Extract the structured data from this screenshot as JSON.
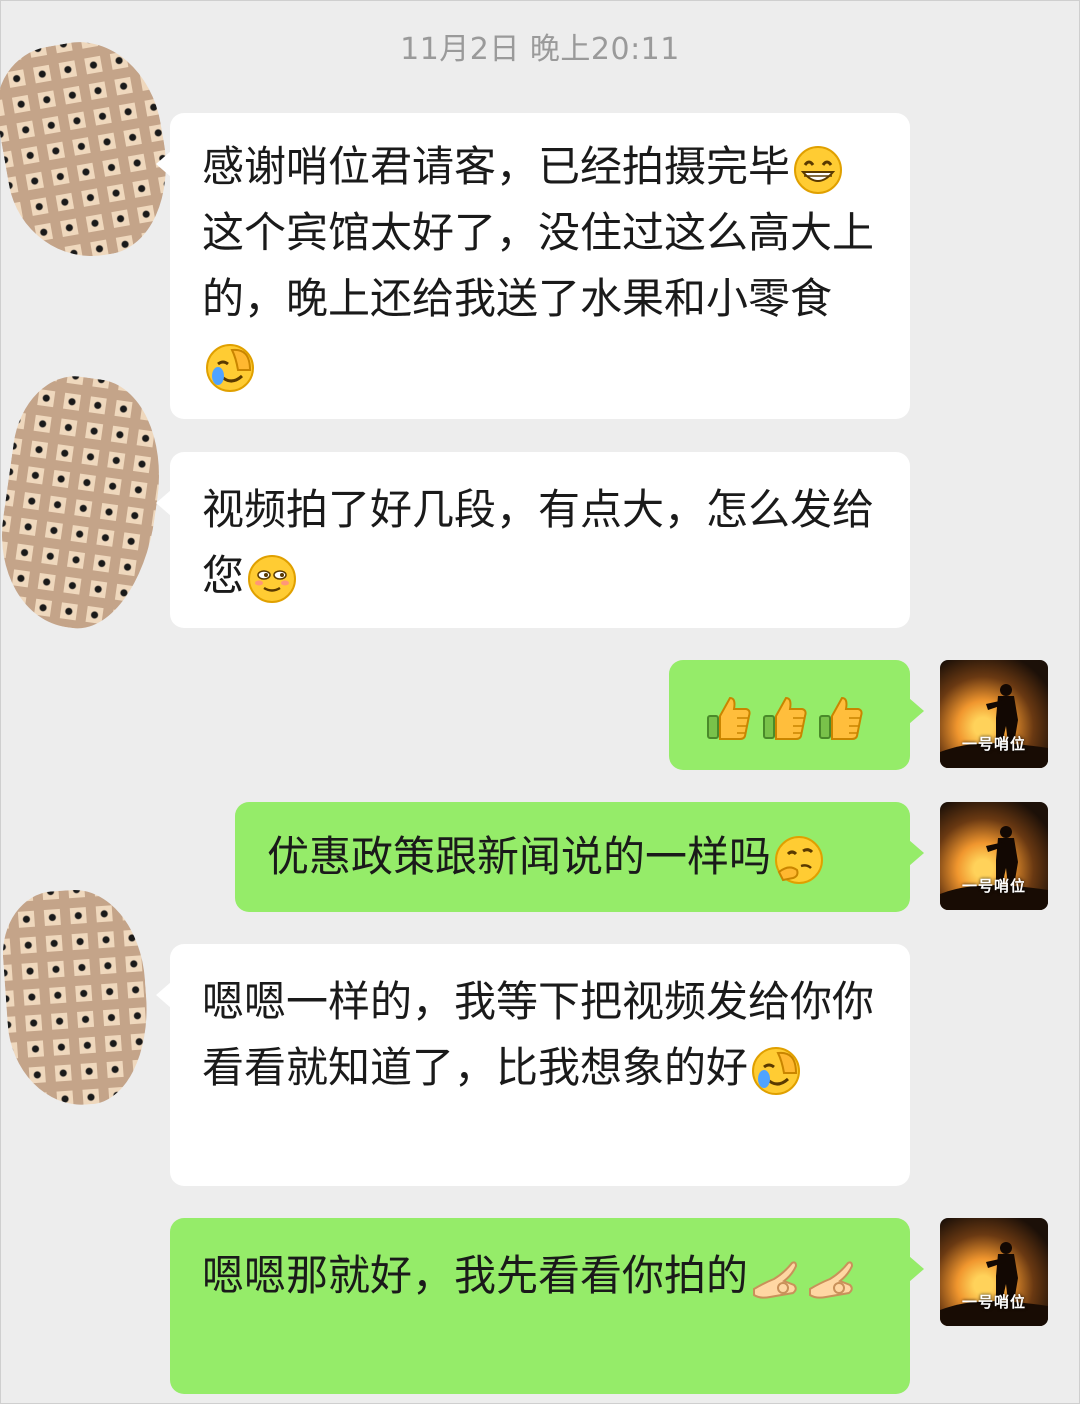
{
  "conversation": {
    "timestamp": "11月2日 晚上20:11",
    "self_avatar_label": "一号哨位",
    "messages": [
      {
        "sender": "other",
        "segments": [
          {
            "text": "感谢哨位君请客，已经拍摄完毕"
          },
          {
            "emoji": "grin-emoji"
          },
          {
            "text": "这个宾馆太好了，没住过这么高大上的，晚上还给我送了水果和小零食"
          },
          {
            "emoji": "facepalm-emoji"
          }
        ]
      },
      {
        "sender": "other",
        "segments": [
          {
            "text": "视频拍了好几段，有点大，怎么发给您"
          },
          {
            "emoji": "shy-emoji"
          }
        ]
      },
      {
        "sender": "self",
        "segments": [
          {
            "emoji": "thumbs-up-emoji"
          },
          {
            "emoji": "thumbs-up-emoji"
          },
          {
            "emoji": "thumbs-up-emoji"
          }
        ]
      },
      {
        "sender": "self",
        "segments": [
          {
            "text": "优惠政策跟新闻说的一样吗"
          },
          {
            "emoji": "thinking-emoji"
          }
        ]
      },
      {
        "sender": "other",
        "segments": [
          {
            "text": "嗯嗯一样的，我等下把视频发给你你看看就知道了，比我想象的好"
          },
          {
            "emoji": "facepalm-emoji"
          }
        ]
      },
      {
        "sender": "self",
        "segments": [
          {
            "text": "嗯嗯那就好，我先看看你拍的"
          },
          {
            "emoji": "ok-hand-emoji"
          },
          {
            "emoji": "ok-hand-emoji"
          }
        ]
      }
    ]
  },
  "colors": {
    "background": "#ededed",
    "incoming_bubble": "#ffffff",
    "outgoing_bubble": "#95ec69",
    "timestamp_text": "#9a9a9a"
  }
}
